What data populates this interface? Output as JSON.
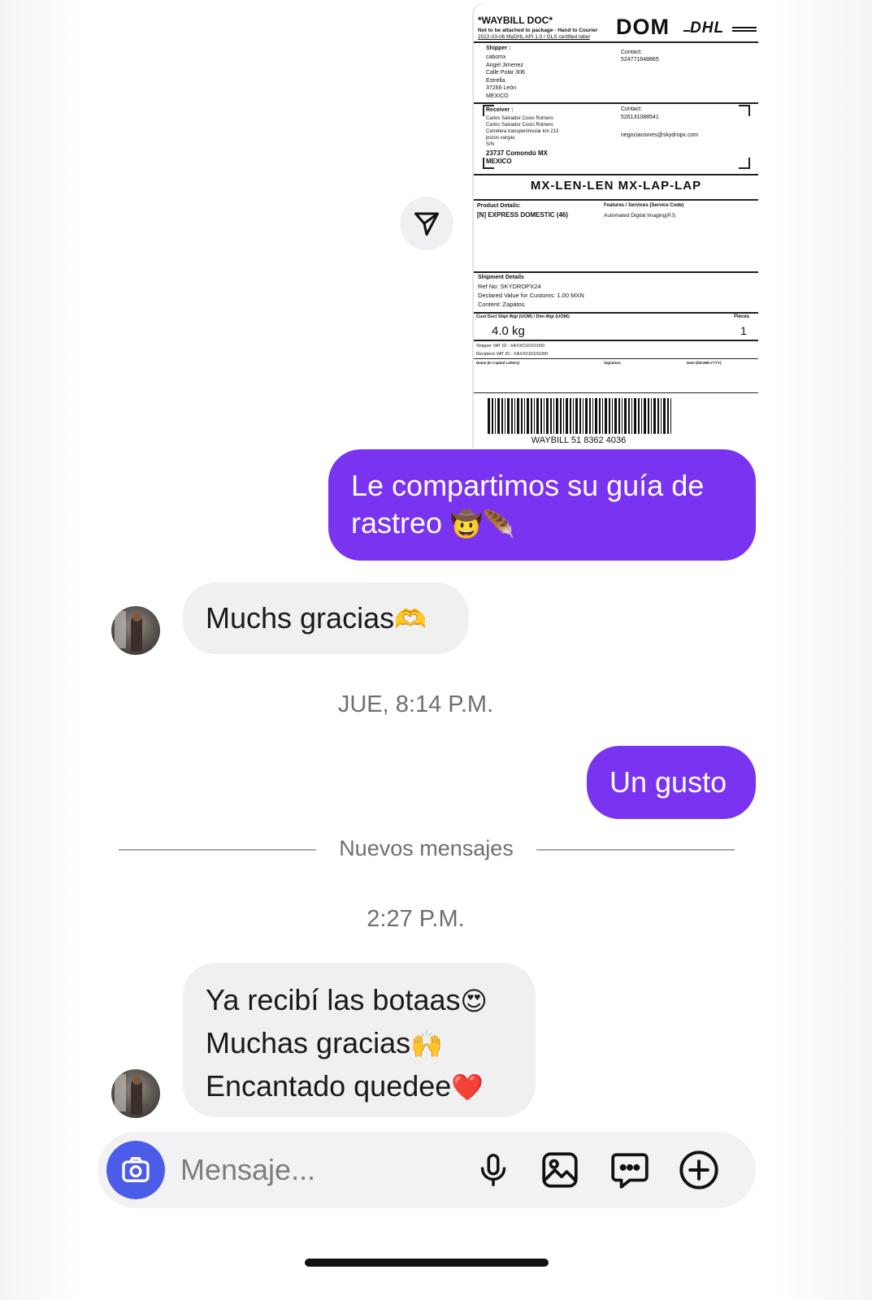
{
  "label": {
    "title": "*WAYBILL DOC*",
    "note": "Not to be attached to package - Hand to Courier",
    "api": "2022-03-06 MyDHL API 1.0 / GLS certified label",
    "service_code": "DOM",
    "carrier": "DHL",
    "shipper_heading": "Shipper :",
    "shipper_lines": "cabomx\nAngel Jimenez\nCalle Polar 306\nEstrella\n37266 León\nMEXICO",
    "shipper_contact_label": "Contact:",
    "shipper_contact": "524771648865",
    "receiver_heading": "Receiver :",
    "receiver_lines": "Carlos Salvador Cosio Romero\nCarlos Salvador Cosio Romero\nCarretera transpeninsular km 213\npozos vargas\nS/N",
    "receiver_city": "23737 Comondú MX\nMEXICO",
    "receiver_contact_label": "Contact:",
    "receiver_contact": "526131088541",
    "receiver_email": "negociaciones@skydropx.com",
    "route": "MX-LEN-LEN  MX-LAP-LAP",
    "product_heading": "Product Details:",
    "product": "[N] EXPRESS DOMESTIC (46)",
    "features_heading": "Features / Services (Service Code)",
    "features": "Automated Digital Imaging(PJ)",
    "shipment_heading": "Shipment Details",
    "shipment_lines": "Ref No: SKYDROPX24\nDeclared Value for Customs: 1.00 MXN\nContent: Zapatos",
    "weight_heading": "Cust Decl Shpt Wgt (UOM) / Dim Wgt (UOM):",
    "pieces_heading": "Pieces",
    "weight": "4.0 kg",
    "pieces": "1",
    "vat_lines": "Shipper VAT ID : XAXX010101000\nRecipient VAT ID : XAXX010101000",
    "name_label": "Name (In Capital Letters)",
    "signature_label": "Signature",
    "date_label": "Date (DD.MM.YYYY)",
    "waybill": "WAYBILL 51 8362 4036"
  },
  "messages": [
    {
      "direction": "outgoing",
      "text": "Le compartimos su guía de rastreo",
      "emoji": "🤠🪶"
    },
    {
      "direction": "incoming",
      "text": "Muchs gracias",
      "emoji": "🫶"
    },
    {
      "direction": "outgoing",
      "text": "Un gusto"
    },
    {
      "direction": "incoming",
      "lines": [
        {
          "text": "Ya recibí las botaas",
          "emoji": "😍"
        },
        {
          "text": "Muchas gracias",
          "emoji": "🙌"
        },
        {
          "text": "Encantado quedee",
          "emoji": "❤️"
        }
      ]
    }
  ],
  "timestamps": {
    "first": "JUE, 8:14 P.M.",
    "second": "2:27 P.M."
  },
  "divider_label": "Nuevos mensajes",
  "composer": {
    "placeholder": "Mensaje..."
  },
  "colors": {
    "outgoing_bubble": "#7a33f0",
    "incoming_bubble": "#f0f0f1",
    "camera_button": "#4b5de8"
  },
  "icons": [
    "send-icon",
    "camera-icon",
    "microphone-icon",
    "image-icon",
    "sticker-chat-icon",
    "plus-circle-icon"
  ]
}
